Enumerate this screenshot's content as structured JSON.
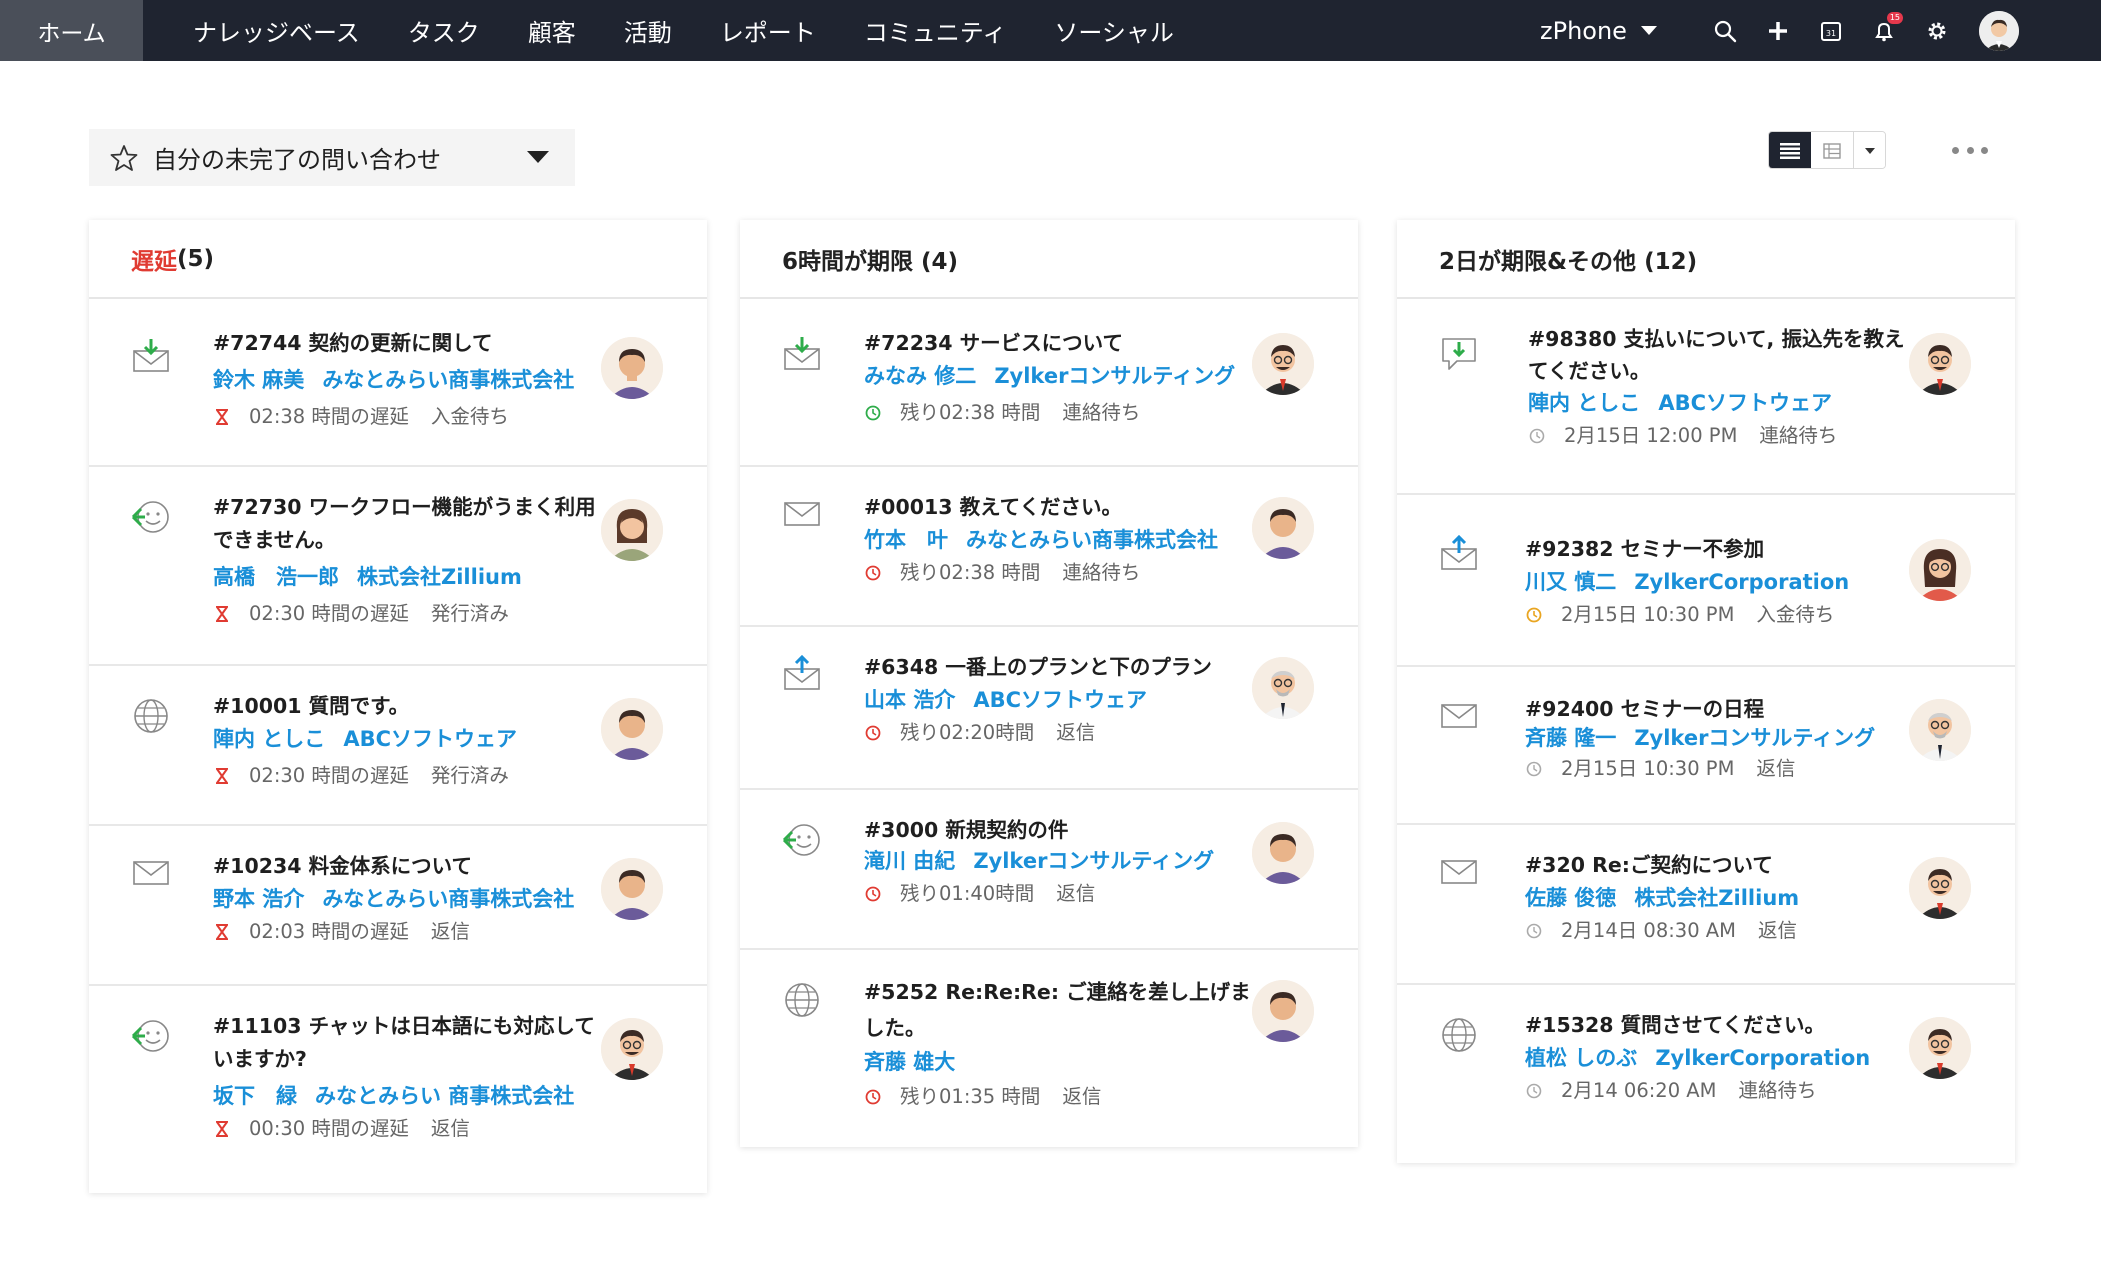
{
  "nav": {
    "home": "ホーム",
    "items": [
      "ナレッジベース",
      "タスク",
      "顧客",
      "活動",
      "レポート",
      "コミュニティ",
      "ソーシャル"
    ],
    "brand": "zPhone",
    "notification_count": "15",
    "icons": [
      "search-icon",
      "plus-icon",
      "calendar-icon",
      "bell-icon",
      "gear-icon"
    ]
  },
  "view": {
    "label": "自分の未完了の問い合わせ"
  },
  "colors": {
    "nav_bg": "#1f2430",
    "link": "#1a8fd8",
    "overdue": "#e03b32",
    "green": "#2eac4a",
    "amber": "#e9a521"
  },
  "columns": [
    {
      "title_prefix": "遅延",
      "title_suffix": "(5)",
      "cards": [
        {
          "channel": "email-in",
          "title": "#72744 契約の更新に関して",
          "contact": "鈴木 麻美",
          "account": "みなとみらい商事株式会社",
          "time": "02:38 時間の遅延",
          "status": "入金待ち",
          "meta_icon": "hourglass"
        },
        {
          "channel": "chat",
          "title": "#72730 ワークフロー機能がうまく利用できません。",
          "contact": "高橋　浩一郎",
          "account": "株式会社Zillium",
          "time": "02:30 時間の遅延",
          "status": "発行済み",
          "meta_icon": "hourglass"
        },
        {
          "channel": "web",
          "title": "#10001 質問です。",
          "contact": "陣内 としこ",
          "account": "ABCソフトウェア",
          "time": "02:30 時間の遅延",
          "status": "発行済み",
          "meta_icon": "hourglass"
        },
        {
          "channel": "email",
          "title": "#10234 料金体系について",
          "contact": "野本 浩介",
          "account": "みなとみらい商事株式会社",
          "time": "02:03 時間の遅延",
          "status": "返信",
          "meta_icon": "hourglass"
        },
        {
          "channel": "chat",
          "title": "#11103 チャットは日本語にも対応していますか?",
          "contact": "坂下　緑",
          "account": "みなとみらい 商事株式会社",
          "time": "00:30 時間の遅延",
          "status": "返信",
          "meta_icon": "hourglass"
        }
      ]
    },
    {
      "title_prefix": "6時間が期限 (4)",
      "title_suffix": "",
      "cards": [
        {
          "channel": "email-in",
          "title": "#72234 サービスについて",
          "contact": "みなみ 修二",
          "account": "Zylkerコンサルティング",
          "time": "残り02:38 時間",
          "status": "連絡待ち",
          "meta_icon": "clock-green"
        },
        {
          "channel": "email",
          "title": "#00013 教えてください。",
          "contact": "竹本　叶",
          "account": "みなとみらい商事株式会社",
          "time": "残り02:38 時間",
          "status": "連絡待ち",
          "meta_icon": "clock-red"
        },
        {
          "channel": "email-out",
          "title": "#6348 一番上のプランと下のプラン",
          "contact": "山本 浩介",
          "account": "ABCソフトウェア",
          "time": "残り02:20時間",
          "status": "返信",
          "meta_icon": "clock-red"
        },
        {
          "channel": "chat",
          "title": "#3000 新規契約の件",
          "contact": "滝川 由紀",
          "account": "Zylkerコンサルティング",
          "time": "残り01:40時間",
          "status": "返信",
          "meta_icon": "clock-red"
        },
        {
          "channel": "web",
          "title": "#5252 Re:Re:Re: ご連絡を差し上げました。",
          "contact": "斉藤 雄大",
          "account": "",
          "time": "残り01:35 時間",
          "status": "返信",
          "meta_icon": "clock-red"
        }
      ]
    },
    {
      "title_prefix": "2日が期限&その他 (12)",
      "title_suffix": "",
      "cards": [
        {
          "channel": "feedback",
          "title": "#98380 支払いについて, 振込先を教えてください。",
          "contact": "陣内 としこ",
          "account": "ABCソフトウェア",
          "time": "2月15日 12:00 PM",
          "status": "連絡待ち",
          "meta_icon": "clock-grey"
        },
        {
          "channel": "email-out",
          "title": "#92382 セミナー不参加",
          "contact": "川又 慎二",
          "account": "ZylkerCorporation",
          "time": "2月15日 10:30 PM",
          "status": "入金待ち",
          "meta_icon": "clock-amber"
        },
        {
          "channel": "email",
          "title": "#92400 セミナーの日程",
          "contact": "斉藤 隆一",
          "account": "Zylkerコンサルティング",
          "time": "2月15日 10:30 PM",
          "status": "返信",
          "meta_icon": "clock-grey"
        },
        {
          "channel": "email",
          "title": "#320 Re:ご契約について",
          "contact": "佐藤 俊徳",
          "account": "株式会社Zillium",
          "time": "2月14日 08:30 AM",
          "status": "返信",
          "meta_icon": "clock-grey"
        },
        {
          "channel": "web",
          "title": "#15328 質問させてください。",
          "contact": "植松 しのぶ",
          "account": "ZylkerCorporation",
          "time": "2月14 06:20 AM",
          "status": "連絡待ち",
          "meta_icon": "clock-grey"
        }
      ]
    }
  ]
}
